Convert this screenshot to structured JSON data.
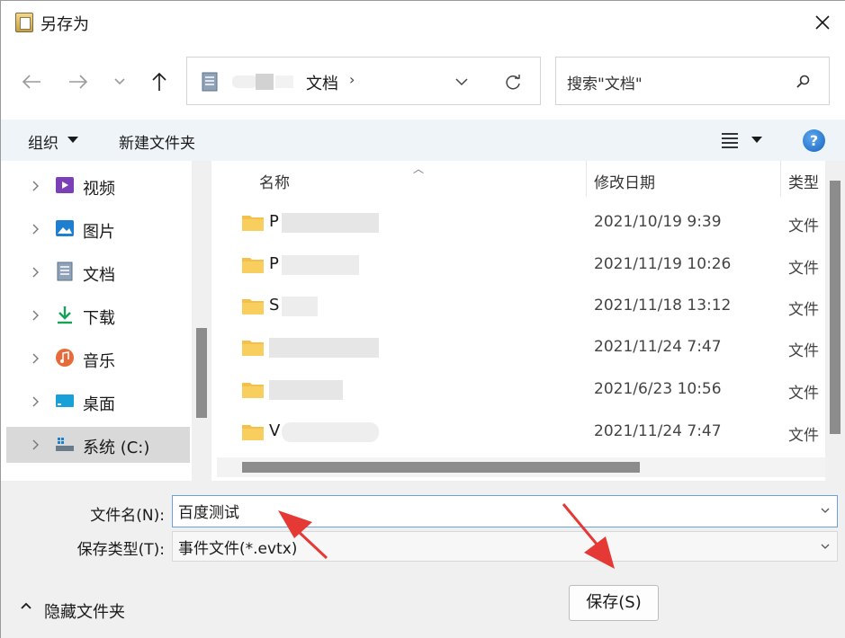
{
  "window": {
    "title": "另存为"
  },
  "nav": {
    "back": "arrow-left-icon",
    "forward": "arrow-right-icon",
    "recent": "chevron-down-icon",
    "up": "arrow-up-icon"
  },
  "address": {
    "current_folder": "文档",
    "separator": "›"
  },
  "search": {
    "placeholder": "搜索\"文档\""
  },
  "toolbar": {
    "organize_label": "组织",
    "new_folder_label": "新建文件夹"
  },
  "sidebar": {
    "items": [
      {
        "label": "视频",
        "icon": "video-folder-icon"
      },
      {
        "label": "图片",
        "icon": "pictures-folder-icon"
      },
      {
        "label": "文档",
        "icon": "documents-folder-icon"
      },
      {
        "label": "下载",
        "icon": "downloads-folder-icon"
      },
      {
        "label": "音乐",
        "icon": "music-folder-icon"
      },
      {
        "label": "桌面",
        "icon": "desktop-folder-icon"
      },
      {
        "label": "系统 (C:)",
        "icon": "drive-icon",
        "selected": true
      }
    ]
  },
  "filelist": {
    "columns": {
      "name": "名称",
      "date": "修改日期",
      "type": "类型"
    },
    "rows": [
      {
        "name": "P",
        "date": "2021/10/19 9:39",
        "type": "文件"
      },
      {
        "name": "P",
        "date": "2021/11/19 10:26",
        "type": "文件"
      },
      {
        "name": "S",
        "date": "2021/11/18 13:12",
        "type": "文件"
      },
      {
        "name": "",
        "date": "2021/11/24 7:47",
        "type": "文件"
      },
      {
        "name": "",
        "date": "2021/6/23 10:56",
        "type": "文件"
      },
      {
        "name": "V",
        "date": "2021/11/24 7:47",
        "type": "文件"
      }
    ]
  },
  "form": {
    "filename_label": "文件名(N):",
    "filename_value": "百度测试",
    "filetype_label": "保存类型(T):",
    "filetype_value": "事件文件(*.evtx)"
  },
  "footer": {
    "hide_folders_label": "隐藏文件夹",
    "save_label": "保存(S)"
  },
  "colors": {
    "accent": "#1565c0",
    "annotation_arrow": "#e53935",
    "folder": "#f4c04a"
  }
}
